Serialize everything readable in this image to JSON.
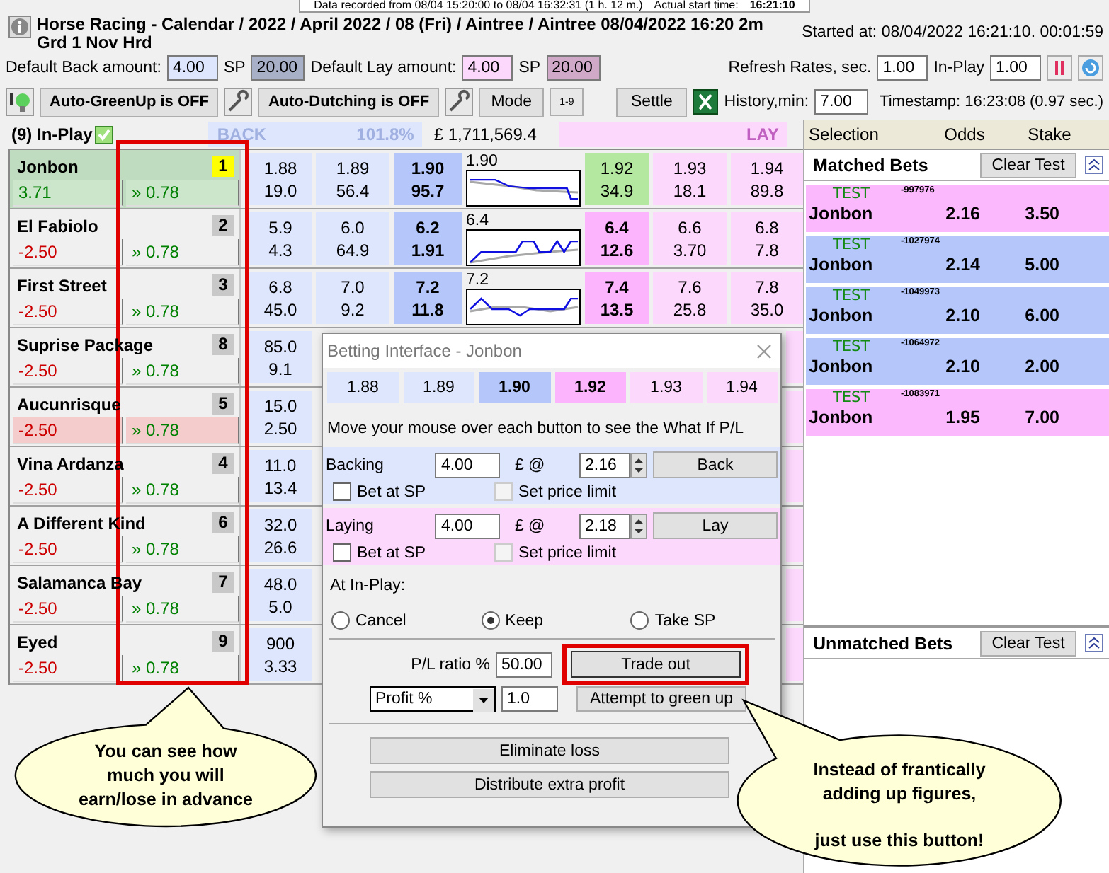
{
  "recording_strip": {
    "text": "Data recorded from 08/04 15:20:00 to 08/04 16:32:31 (1 h. 12 m.)",
    "start_label": "Actual start time:",
    "start_value": "16:21:10"
  },
  "header": {
    "title": "Horse Racing - Calendar / 2022 / April 2022 / 08 (Fri) / Aintree / Aintree 08/04/2022 16:20 2m Grd 1 Nov Hrd",
    "started": "Started at: 08/04/2022 16:21:10. 00:01:59"
  },
  "amounts": {
    "back_label": "Default Back amount:",
    "back_value": "4.00",
    "back_sp_label": "SP",
    "back_sp_value": "20.00",
    "lay_label": "Default Lay amount:",
    "lay_value": "4.00",
    "lay_sp_label": "SP",
    "lay_sp_value": "20.00",
    "refresh_label": "Refresh Rates, sec.",
    "refresh_value": "1.00",
    "inplay_label": "In-Play",
    "inplay_value": "1.00"
  },
  "toolbar": {
    "autogreen": "Auto-GreenUp is OFF",
    "autodutch": "Auto-Dutching is OFF",
    "mode": "Mode",
    "sort_label": "1-9",
    "settle": "Settle",
    "history_label": "History,min:",
    "history_value": "7.00",
    "timestamp": "Timestamp: 16:23:08 (0.97 sec.)"
  },
  "market": {
    "status": "(9) In-Play",
    "inplay_checked": true,
    "back_label": "BACK",
    "back_pct": "101.8%",
    "matched": "£ 1,711,569.4",
    "lay_label": "LAY"
  },
  "runners": [
    {
      "name": "Jonbon",
      "number": "1",
      "selected": true,
      "pnl": "3.71",
      "color": "#008000",
      "highlighted": true,
      "green": "» 0.78",
      "trend": "1.90",
      "prices": [
        {
          "odds": "1.88",
          "amount": "19.0",
          "kind": "back"
        },
        {
          "odds": "1.89",
          "amount": "56.4",
          "kind": "back"
        },
        {
          "odds": "1.90",
          "amount": "95.7",
          "kind": "back_best"
        },
        {
          "odds": "1.92",
          "amount": "34.9",
          "kind": "traded"
        },
        {
          "odds": "1.93",
          "amount": "18.1",
          "kind": "lay"
        },
        {
          "odds": "1.94",
          "amount": "89.8",
          "kind": "lay"
        }
      ]
    },
    {
      "name": "El Fabiolo",
      "number": "2",
      "selected": false,
      "pnl": "-2.50",
      "color": "#cc0000",
      "highlighted": false,
      "green": "» 0.78",
      "trend": "6.4",
      "prices": [
        {
          "odds": "5.9",
          "amount": "4.3",
          "kind": "back"
        },
        {
          "odds": "6.0",
          "amount": "64.9",
          "kind": "back"
        },
        {
          "odds": "6.2",
          "amount": "1.91",
          "kind": "back_best"
        },
        {
          "odds": "6.4",
          "amount": "12.6",
          "kind": "lay_best"
        },
        {
          "odds": "6.6",
          "amount": "3.70",
          "kind": "lay"
        },
        {
          "odds": "6.8",
          "amount": "7.8",
          "kind": "lay"
        }
      ]
    },
    {
      "name": "First Street",
      "number": "3",
      "selected": false,
      "pnl": "-2.50",
      "color": "#cc0000",
      "highlighted": false,
      "green": "» 0.78",
      "trend": "7.2",
      "prices": [
        {
          "odds": "6.8",
          "amount": "45.0",
          "kind": "back"
        },
        {
          "odds": "7.0",
          "amount": "9.2",
          "kind": "back"
        },
        {
          "odds": "7.2",
          "amount": "11.8",
          "kind": "back_best"
        },
        {
          "odds": "7.4",
          "amount": "13.5",
          "kind": "lay_best"
        },
        {
          "odds": "7.6",
          "amount": "25.8",
          "kind": "lay"
        },
        {
          "odds": "7.8",
          "amount": "35.0",
          "kind": "lay"
        }
      ]
    },
    {
      "name": "Suprise Package",
      "number": "8",
      "selected": false,
      "pnl": "-2.50",
      "color": "#cc0000",
      "highlighted": false,
      "green": "» 0.78",
      "prices": [
        {
          "odds": "85.0",
          "amount": "9.1",
          "kind": "back"
        }
      ]
    },
    {
      "name": "Aucunrisque",
      "number": "5",
      "selected": false,
      "pnl": "-2.50",
      "color": "#cc0000",
      "highlighted": true,
      "green": "» 0.78",
      "prices": [
        {
          "odds": "15.0",
          "amount": "2.50",
          "kind": "back"
        }
      ]
    },
    {
      "name": "Vina Ardanza",
      "number": "4",
      "selected": false,
      "pnl": "-2.50",
      "color": "#cc0000",
      "highlighted": false,
      "green": "» 0.78",
      "prices": [
        {
          "odds": "11.0",
          "amount": "13.4",
          "kind": "back"
        }
      ]
    },
    {
      "name": "A Different Kind",
      "number": "6",
      "selected": false,
      "pnl": "-2.50",
      "color": "#cc0000",
      "highlighted": false,
      "green": "» 0.78",
      "prices": [
        {
          "odds": "32.0",
          "amount": "26.6",
          "kind": "back"
        }
      ]
    },
    {
      "name": "Salamanca Bay",
      "number": "7",
      "selected": false,
      "pnl": "-2.50",
      "color": "#cc0000",
      "highlighted": false,
      "green": "» 0.78",
      "prices": [
        {
          "odds": "48.0",
          "amount": "5.0",
          "kind": "back"
        }
      ]
    },
    {
      "name": "Eyed",
      "number": "9",
      "selected": false,
      "pnl": "-2.50",
      "color": "#cc0000",
      "highlighted": false,
      "green": "» 0.78",
      "prices": [
        {
          "odds": "900",
          "amount": "3.33",
          "kind": "back"
        }
      ]
    }
  ],
  "bets_columns": [
    "Selection",
    "Odds",
    "Stake"
  ],
  "matched": {
    "title": "Matched Bets",
    "clear": "Clear Test",
    "bets": [
      {
        "tag": "TEST",
        "ref": "-997976",
        "selection": "Jonbon",
        "odds": "2.16",
        "stake": "3.50",
        "color": "#fcb8fc"
      },
      {
        "tag": "TEST",
        "ref": "-1027974",
        "selection": "Jonbon",
        "odds": "2.14",
        "stake": "5.00",
        "color": "#b4c6fa"
      },
      {
        "tag": "TEST",
        "ref": "-1049973",
        "selection": "Jonbon",
        "odds": "2.10",
        "stake": "6.00",
        "color": "#b4c6fa"
      },
      {
        "tag": "TEST",
        "ref": "-1064972",
        "selection": "Jonbon",
        "odds": "2.10",
        "stake": "2.00",
        "color": "#b4c6fa"
      },
      {
        "tag": "TEST",
        "ref": "-1083971",
        "selection": "Jonbon",
        "odds": "1.95",
        "stake": "7.00",
        "color": "#fcb8fc"
      }
    ]
  },
  "unmatched": {
    "title": "Unmatched Bets",
    "clear": "Clear Test"
  },
  "dialog": {
    "title": "Betting Interface - Jonbon",
    "ladder": [
      {
        "odds": "1.88",
        "kind": "back"
      },
      {
        "odds": "1.89",
        "kind": "back"
      },
      {
        "odds": "1.90",
        "kind": "back_best"
      },
      {
        "odds": "1.92",
        "kind": "lay_best"
      },
      {
        "odds": "1.93",
        "kind": "lay"
      },
      {
        "odds": "1.94",
        "kind": "lay"
      }
    ],
    "hint": "Move your mouse over each button to see the What If P/L",
    "sides": [
      {
        "kind": "back",
        "label": "Backing",
        "stake": "4.00",
        "currency": "£ @",
        "price": "2.16",
        "button": "Back",
        "sp_label": "Bet at SP",
        "sp_checked": false,
        "limit_label": "Set price limit",
        "limit_checked": false
      },
      {
        "kind": "lay",
        "label": "Laying",
        "stake": "4.00",
        "currency": "£ @",
        "price": "2.18",
        "button": "Lay",
        "sp_label": "Bet at SP",
        "sp_checked": false,
        "limit_label": "Set price limit",
        "limit_checked": false
      }
    ],
    "inplay_label": "At In-Play:",
    "inplay_options": [
      {
        "label": "Cancel",
        "selected": false
      },
      {
        "label": "Keep",
        "selected": true
      },
      {
        "label": "Take SP",
        "selected": false
      }
    ],
    "pl_label": "P/L ratio %",
    "pl_value": "50.00",
    "trade_out": "Trade out",
    "mode": "Profit %",
    "mode_value": "1.0",
    "green_up": "Attempt to green up",
    "eliminate": "Eliminate loss",
    "distribute": "Distribute extra profit"
  },
  "callouts": [
    {
      "paragraphs": [
        [
          "You can see how",
          "much you will",
          "earn/lose in advance"
        ]
      ]
    },
    {
      "paragraphs": [
        [
          "Instead of frantically",
          "adding up figures,"
        ],
        [
          "just use this button!"
        ]
      ]
    }
  ]
}
